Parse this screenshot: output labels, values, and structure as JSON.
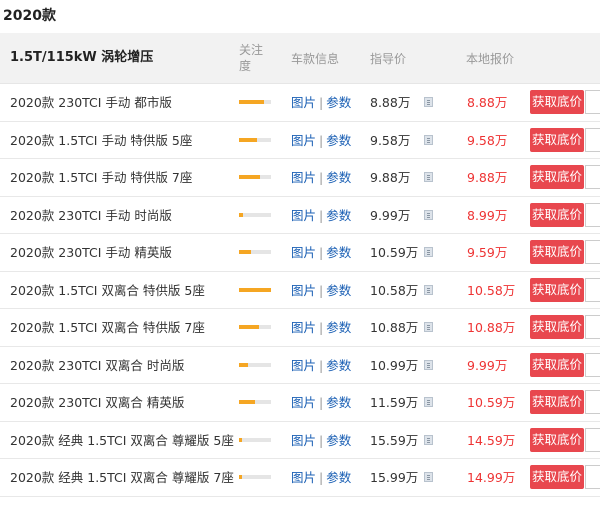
{
  "year_title": "2020款",
  "header": {
    "engine": "1.5T/115kW 涡轮增压",
    "attention": "关注度",
    "info": "车款信息",
    "guide_price": "指导价",
    "local_price": "本地报价"
  },
  "labels": {
    "pics": "图片",
    "sep": "|",
    "params": "参数",
    "get_price_button": "获取底价"
  },
  "rows": [
    {
      "name": "2020款 230TCI 手动 都市版",
      "attention": 0.78,
      "guide": "8.88万",
      "local": "8.88万"
    },
    {
      "name": "2020款 1.5TCI 手动 特供版 5座",
      "attention": 0.56,
      "guide": "9.58万",
      "local": "9.58万"
    },
    {
      "name": "2020款 1.5TCI 手动 特供版 7座",
      "attention": 0.66,
      "guide": "9.88万",
      "local": "9.88万"
    },
    {
      "name": "2020款 230TCI 手动 时尚版",
      "attention": 0.12,
      "guide": "9.99万",
      "local": "8.99万"
    },
    {
      "name": "2020款 230TCI 手动 精英版",
      "attention": 0.38,
      "guide": "10.59万",
      "local": "9.59万"
    },
    {
      "name": "2020款 1.5TCI 双离合 特供版 5座",
      "attention": 1.0,
      "guide": "10.58万",
      "local": "10.58万"
    },
    {
      "name": "2020款 1.5TCI 双离合 特供版 7座",
      "attention": 0.62,
      "guide": "10.88万",
      "local": "10.88万"
    },
    {
      "name": "2020款 230TCI 双离合 时尚版",
      "attention": 0.28,
      "guide": "10.99万",
      "local": "9.99万"
    },
    {
      "name": "2020款 230TCI 双离合 精英版",
      "attention": 0.5,
      "guide": "11.59万",
      "local": "10.59万"
    },
    {
      "name": "2020款 经典 1.5TCI 双离合 尊耀版 5座",
      "attention": 0.1,
      "guide": "15.59万",
      "local": "14.59万"
    },
    {
      "name": "2020款 经典 1.5TCI 双离合 尊耀版 7座",
      "attention": 0.1,
      "guide": "15.99万",
      "local": "14.99万"
    }
  ],
  "icons": {
    "calculator": "calculator-icon"
  },
  "colors": {
    "accent_bar": "#f5a623",
    "local_price": "#ee3333",
    "button": "#e8474e",
    "link": "#1a5fb4"
  }
}
